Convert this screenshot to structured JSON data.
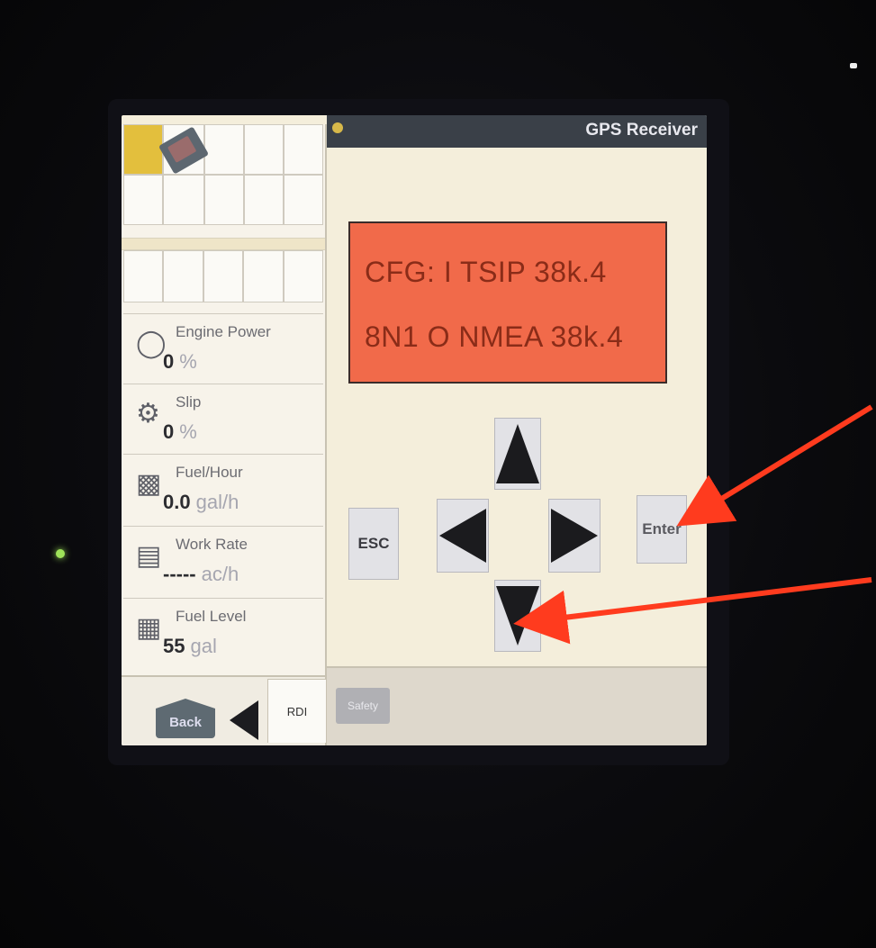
{
  "header": {
    "title": "GPS Receiver"
  },
  "display": {
    "line1": "CFG: I TSIP  38k.4",
    "line2": "8N1 O NMEA  38k.4"
  },
  "buttons": {
    "esc": "ESC",
    "enter": "Enter"
  },
  "meters": [
    {
      "label": "Engine Power",
      "value": "0",
      "unit": "%",
      "icon": "engine-icon"
    },
    {
      "label": "Slip",
      "value": "0",
      "unit": "%",
      "icon": "tractor-icon"
    },
    {
      "label": "Fuel/Hour",
      "value": "0.0",
      "unit": "gal/h",
      "icon": "fuel-pump-icon"
    },
    {
      "label": "Work Rate",
      "value": "-----",
      "unit": "ac/h",
      "icon": "work-rate-icon"
    },
    {
      "label": "Fuel Level",
      "value": "55",
      "unit": "gal",
      "icon": "fuel-tank-icon"
    }
  ],
  "footer": {
    "back": "Back",
    "rdi": "RDI",
    "safety": "Safety"
  },
  "colors": {
    "lcd": "#f16a4a",
    "arrow": "#ff3b1e",
    "titlebar": "#3a4048",
    "tile_selected": "#e3bf3d"
  }
}
